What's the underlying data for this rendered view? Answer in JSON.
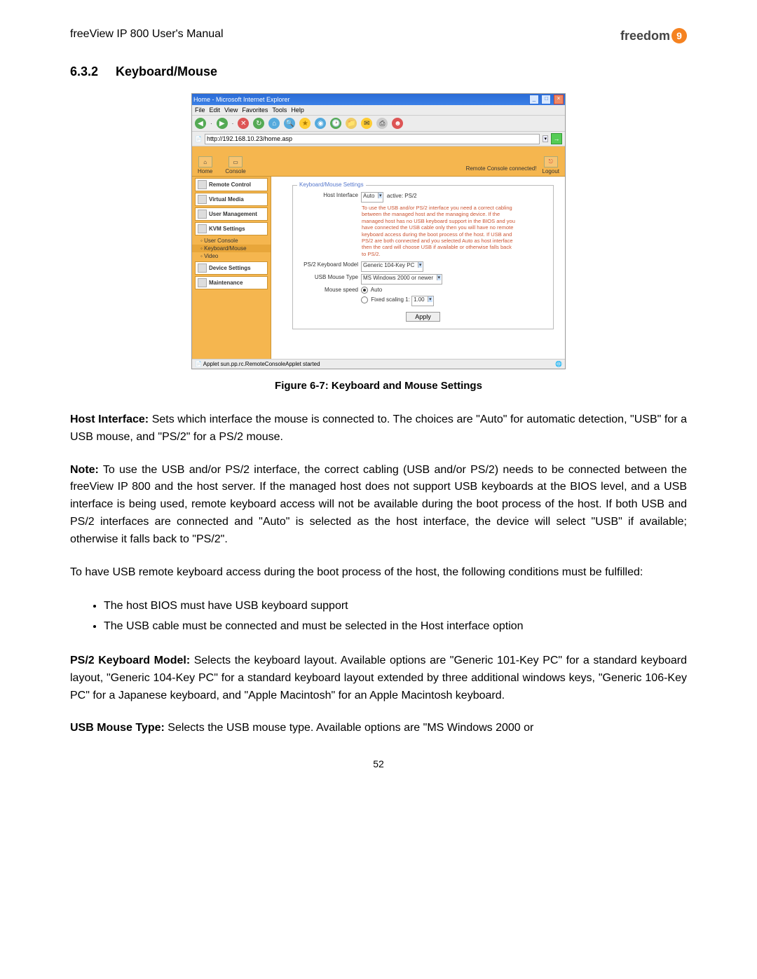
{
  "header": {
    "doc_title": "freeView IP 800 User's Manual",
    "logo_text": "freedom",
    "logo_badge": "9"
  },
  "section": {
    "number": "6.3.2",
    "title": "Keyboard/Mouse"
  },
  "figure": {
    "browser_title": "Home - Microsoft Internet Explorer",
    "menubar": {
      "file": "File",
      "edit": "Edit",
      "view": "View",
      "favorites": "Favorites",
      "tools": "Tools",
      "help": "Help"
    },
    "address": "http://192.168.10.23/home.asp",
    "topnav": {
      "home": "Home",
      "console": "Console",
      "status": "Remote Console connected!",
      "logout": "Logout"
    },
    "sidebar": {
      "remote_control": "Remote Control",
      "virtual_media": "Virtual Media",
      "user_mgmt": "User Management",
      "kvm_settings": "KVM Settings",
      "user_console": "User Console",
      "keyboard_mouse": "Keyboard/Mouse",
      "video": "Video",
      "device_settings": "Device Settings",
      "maintenance": "Maintenance"
    },
    "panel": {
      "legend": "Keyboard/Mouse Settings",
      "host_interface_label": "Host Interface",
      "host_interface_value": "Auto",
      "host_interface_active": "active: PS/2",
      "help": "To use the USB and/or PS/2 interface you need a correct cabling between the managed host and the managing device. If the managed host has no USB keyboard support in the BIOS and you have connected the USB cable only then you will have no remote keyboard access during the boot process of the host. If USB and PS/2 are both connected and you selected Auto as host interface then the card will choose USB if available or otherwise falls back to PS/2.",
      "kb_model_label": "PS/2 Keyboard Model",
      "kb_model_value": "Generic 104-Key PC",
      "usb_mouse_label": "USB Mouse Type",
      "usb_mouse_value": "MS Windows 2000 or newer",
      "mouse_speed_label": "Mouse speed",
      "mouse_speed_auto": "Auto",
      "mouse_speed_fixed": "Fixed scaling 1:",
      "mouse_speed_fixed_value": "1.00",
      "apply": "Apply"
    },
    "statusbar": "Applet sun.pp.rc.RemoteConsoleApplet started",
    "caption": "Figure 6-7: Keyboard and Mouse Settings"
  },
  "body": {
    "p1_label": "Host Interface:",
    "p1_text": " Sets which interface the mouse is connected to. The choices are \"Auto\" for automatic detection, \"USB\" for a USB mouse, and \"PS/2\" for a PS/2 mouse.",
    "p2_label": "Note:",
    "p2_text": " To use the USB and/or PS/2 interface, the correct cabling (USB and/or PS/2) needs to be connected between the freeView IP 800 and the host server. If the managed host does not support USB keyboards at the BIOS level, and a USB interface is being used, remote keyboard access will not be available during the boot process of the host. If both USB and PS/2 interfaces are connected and \"Auto\" is selected as the host interface, the device will select \"USB\" if available; otherwise it falls back to \"PS/2\".",
    "p3": "To have USB remote keyboard access during the boot process of the host, the following conditions must be fulfilled:",
    "li1": "The host BIOS must have USB keyboard support",
    "li2": "The USB cable must be connected and must be selected in the Host interface option",
    "p4_label": "PS/2 Keyboard Model:",
    "p4_text": " Selects the keyboard layout. Available options are \"Generic 101-Key PC\" for a standard keyboard layout, \"Generic 104-Key PC\" for a standard keyboard layout extended by three additional windows keys, \"Generic 106-Key PC\" for a Japanese keyboard, and \"Apple Macintosh\" for an Apple Macintosh keyboard.",
    "p5_label": "USB Mouse Type:",
    "p5_text": " Selects the USB mouse type. Available options are \"MS Windows 2000 or"
  },
  "page_number": "52"
}
